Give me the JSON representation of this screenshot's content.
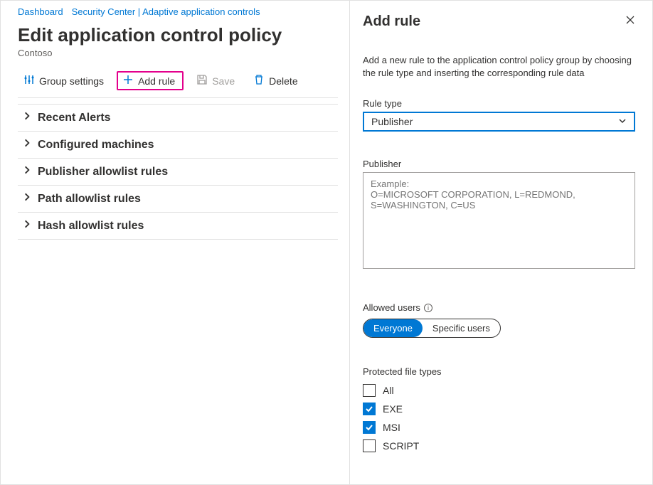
{
  "breadcrumb": {
    "items": [
      "Dashboard",
      "Security Center | Adaptive application controls"
    ]
  },
  "page": {
    "title": "Edit application control policy",
    "subtitle": "Contoso"
  },
  "toolbar": {
    "group_settings": "Group settings",
    "add_rule": "Add rule",
    "save": "Save",
    "delete": "Delete"
  },
  "sections": [
    {
      "label": "Recent Alerts"
    },
    {
      "label": "Configured machines"
    },
    {
      "label": "Publisher allowlist rules"
    },
    {
      "label": "Path allowlist rules"
    },
    {
      "label": "Hash allowlist rules"
    }
  ],
  "panel": {
    "title": "Add rule",
    "description": "Add a new rule to the application control policy group by choosing the rule type and inserting the corresponding rule data",
    "rule_type_label": "Rule type",
    "rule_type_value": "Publisher",
    "publisher_label": "Publisher",
    "publisher_placeholder": "Example:\nO=MICROSOFT CORPORATION, L=REDMOND, S=WASHINGTON, C=US",
    "allowed_users_label": "Allowed users",
    "toggles": {
      "everyone": "Everyone",
      "specific": "Specific users"
    },
    "protected_label": "Protected file types",
    "file_types": [
      {
        "label": "All",
        "checked": false
      },
      {
        "label": "EXE",
        "checked": true
      },
      {
        "label": "MSI",
        "checked": true
      },
      {
        "label": "SCRIPT",
        "checked": false
      }
    ]
  }
}
